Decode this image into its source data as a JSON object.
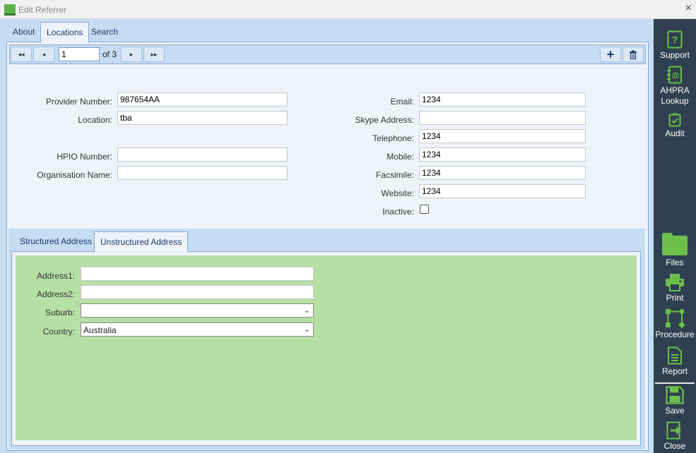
{
  "window": {
    "title": "Edit Referrer",
    "close_glyph": "×"
  },
  "tabs": [
    "About",
    "Locations",
    "Search"
  ],
  "nav": {
    "page": "1",
    "of_label": "of 3",
    "first": "◂◂",
    "prev": "◂",
    "next": "▸",
    "last": "▸▸",
    "add": "+",
    "delete": "🗑"
  },
  "form_left": {
    "provider_number": {
      "label": "Provider Number:",
      "value": "987654AA"
    },
    "location": {
      "label": "Location:",
      "value": "tba"
    },
    "hpio_number": {
      "label": "HPIO Number:",
      "value": ""
    },
    "organisation_name": {
      "label": "Organisation Name:",
      "value": ""
    }
  },
  "form_right": {
    "email": {
      "label": "Email:",
      "value": "1234"
    },
    "skype": {
      "label": "Skype Address:",
      "value": ""
    },
    "telephone": {
      "label": "Telephone:",
      "value": "1234"
    },
    "mobile": {
      "label": "Mobile:",
      "value": "1234"
    },
    "facsimile": {
      "label": "Facsimile:",
      "value": "1234"
    },
    "website": {
      "label": "Website:",
      "value": "1234"
    },
    "inactive": {
      "label": "Inactive:",
      "checked": false
    }
  },
  "address_tabs": [
    "Structured Address",
    "Unstructured Address"
  ],
  "address": {
    "address1": {
      "label": "Address1:",
      "value": ""
    },
    "address2": {
      "label": "Address2:",
      "value": ""
    },
    "suburb": {
      "label": "Suburb:",
      "value": ""
    },
    "country": {
      "label": "Country:",
      "value": "Australia"
    }
  },
  "sidebar": {
    "support": "Support",
    "ahpra_1": "AHPRA",
    "ahpra_2": "Lookup",
    "audit": "Audit",
    "files": "Files",
    "print": "Print",
    "procedure": "Procedure",
    "report": "Report",
    "save": "Save",
    "close": "Close"
  },
  "colors": {
    "accent_green": "#6cc04a",
    "sidebar_bg": "#2f4150",
    "panel_blue": "#c5dcf3",
    "address_green": "#b6dfa5"
  }
}
